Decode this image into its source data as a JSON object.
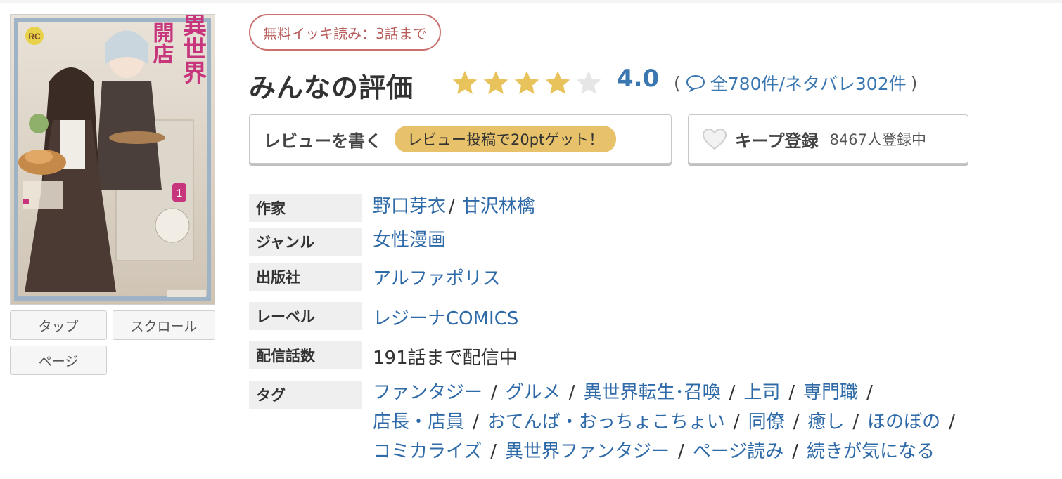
{
  "cover": {
    "title_text": "異世界でカフェを開店しました。",
    "volume": "1",
    "author_credits": [
      "甘沢林檎",
      "野口芽衣"
    ],
    "imprint_logo": "RC",
    "publisher_mark": "アルファポリス"
  },
  "view_modes": [
    "タップ",
    "スクロール",
    "ページ"
  ],
  "free_badge": "無料イッキ読み：3話まで",
  "rating": {
    "title": "みんなの評価",
    "stars_filled": 4,
    "stars_total": 5,
    "score": "4.0",
    "open_paren": "(",
    "close_paren": ")",
    "count_text": "全780件/ネタバレ302件",
    "comment_icon": "speech-bubble-icon",
    "star_color": "#e8c25a",
    "star_empty_color": "#e6e6e6"
  },
  "write_review": {
    "label": "レビューを書く",
    "bonus": "レビュー投稿で20ptゲット！"
  },
  "keep": {
    "label": "キープ登録",
    "count": "8467人登録中",
    "icon": "heart-icon"
  },
  "info": {
    "author_label": "作家",
    "authors": [
      "野口芽衣",
      "甘沢林檎"
    ],
    "author_sep": "/",
    "genre_label": "ジャンル",
    "genre": "女性漫画",
    "publisher_label": "出版社",
    "publisher": "アルファポリス",
    "label_label": "レーベル",
    "label": "レジーナCOMICS",
    "episodes_label": "配信話数",
    "episodes": "191話まで配信中",
    "tags_label": "タグ",
    "tag_sep": "/",
    "tag_rows": [
      [
        "ファンタジー",
        "グルメ",
        "異世界転生･召喚",
        "上司",
        "専門職"
      ],
      [
        "店長・店員",
        "おてんば・おっちょこちょい",
        "同僚",
        "癒し",
        "ほのぼの"
      ],
      [
        "コミカライズ",
        "異世界ファンタジー",
        "ページ読み",
        "続きが気になる"
      ]
    ]
  },
  "colors": {
    "link": "#2f6aa8",
    "score": "#3a76b0",
    "badge_border": "#c8716f",
    "bonus_pill": "#e7c26a"
  }
}
